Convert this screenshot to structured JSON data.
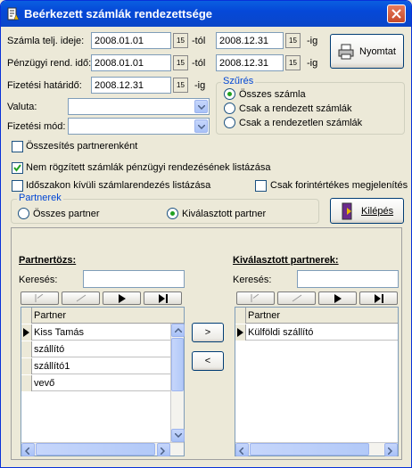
{
  "window": {
    "title": "Beérkezett számlák rendezettsége"
  },
  "filters": {
    "teljesites_label": "Számla telj. ideje:",
    "teljesites_from": "2008.01.01",
    "teljesites_from_suffix": "-tól",
    "teljesites_to": "2008.12.31",
    "teljesites_to_suffix": "-ig",
    "penzugyi_label": "Pénzügyi rend. idő:",
    "penzugyi_from": "2008.01.01",
    "penzugyi_from_suffix": "-tól",
    "penzugyi_to": "2008.12.31",
    "penzugyi_to_suffix": "-ig",
    "hatarido_label": "Fizetési határidő:",
    "hatarido_value": "2008.12.31",
    "hatarido_suffix": "-ig",
    "valuta_label": "Valuta:",
    "valuta_value": "",
    "fizmod_label": "Fizetési mód:",
    "fizmod_value": "",
    "cal_glyph": "15"
  },
  "print_button": {
    "label": "Nyomtat"
  },
  "exit_button": {
    "label": "Kilépés"
  },
  "szures": {
    "title": "Szűrés",
    "options": [
      {
        "label": "Összes számla",
        "selected": true
      },
      {
        "label": "Csak a rendezett számlák",
        "selected": false
      },
      {
        "label": "Csak a rendezetlen számlák",
        "selected": false
      }
    ]
  },
  "checkboxes": {
    "osszesites": {
      "label": "Összesítés partnerenként",
      "checked": false
    },
    "nem_rogzitett": {
      "label": "Nem rögzített számlák pénzügyi rendezésének listázása",
      "checked": true
    },
    "idoszakon_kivuli": {
      "label": "Időszakon kívüli számlarendezés listázása",
      "checked": false
    },
    "forint": {
      "label": "Csak forintértékes megjelenítés",
      "checked": false
    }
  },
  "partnerek": {
    "title": "Partnerek",
    "options": [
      {
        "label": "Összes partner",
        "selected": false
      },
      {
        "label": "Kiválasztott partner",
        "selected": true
      }
    ]
  },
  "left_list": {
    "title": "Partnertözs:",
    "search_label": "Keresés:",
    "search_value": "",
    "column": "Partner",
    "rows": [
      "Kiss Tamás",
      "szállító",
      "szállító1",
      "vevő"
    ]
  },
  "right_list": {
    "title": "Kiválasztott partnerek:",
    "search_label": "Keresés:",
    "search_value": "",
    "column": "Partner",
    "rows": [
      "Külföldi szállító"
    ]
  },
  "transfer": {
    "add": ">",
    "remove": "<"
  },
  "colors": {
    "title_bar": "#0548d8",
    "group_title": "#0046d5",
    "check_green": "#21a121"
  }
}
